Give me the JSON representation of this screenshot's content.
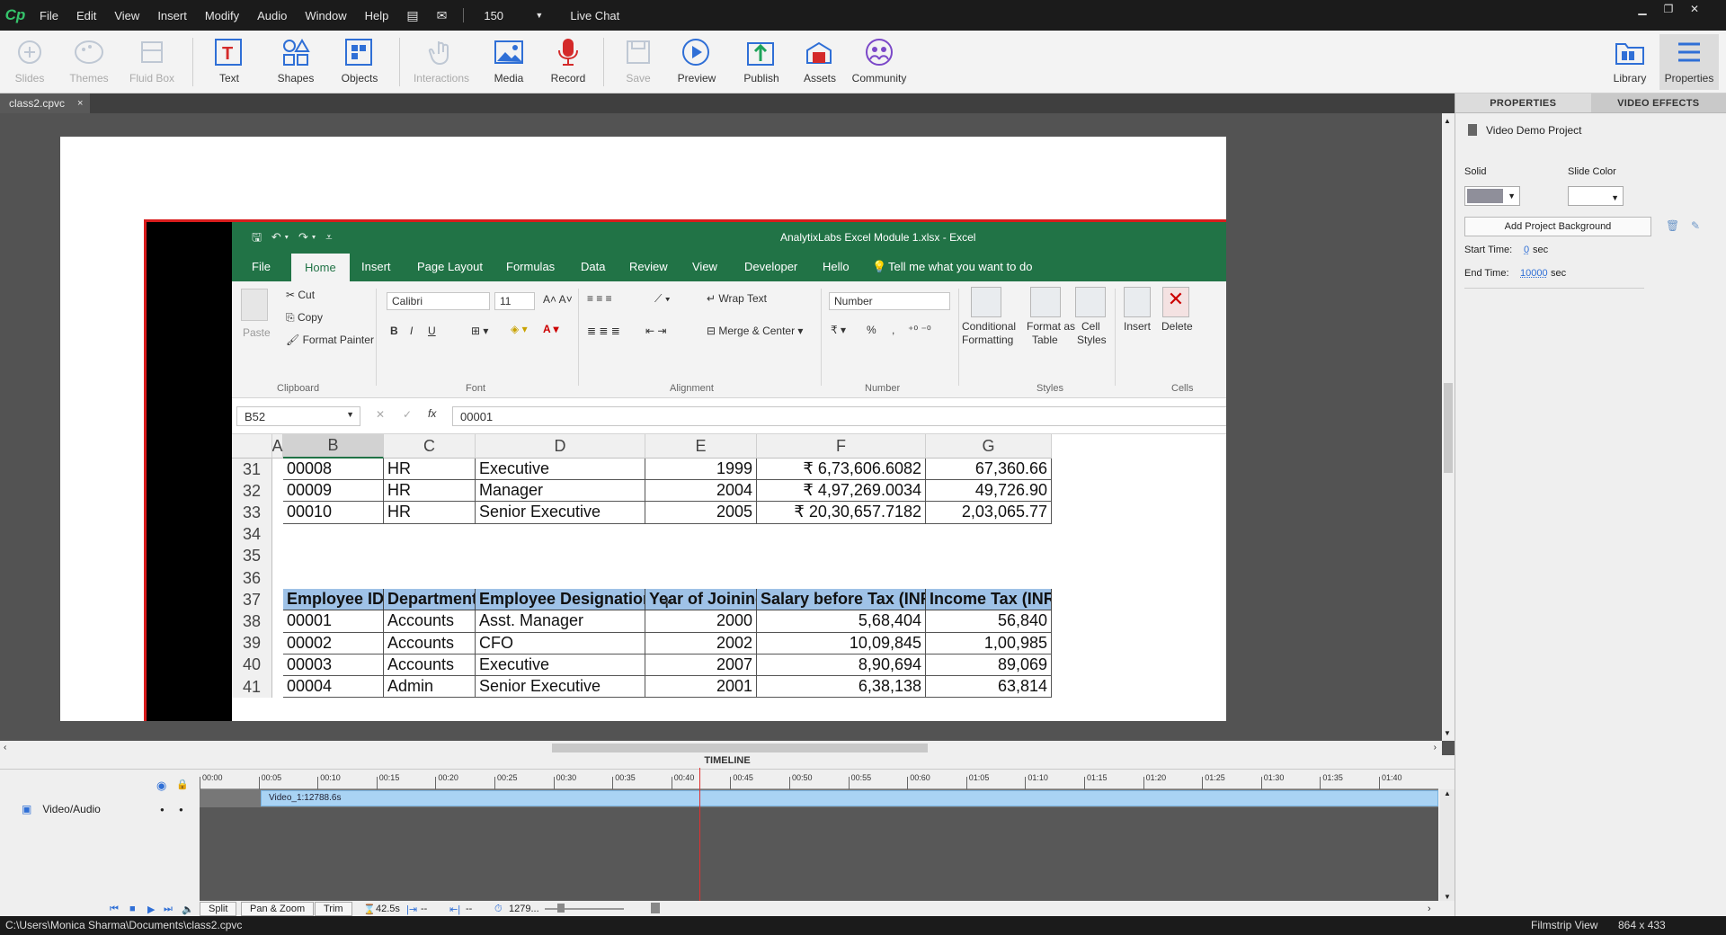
{
  "app": {
    "logo": "Cp",
    "zoom": "150",
    "live_chat": "Live Chat"
  },
  "menu": [
    "File",
    "Edit",
    "View",
    "Insert",
    "Modify",
    "Audio",
    "Window",
    "Help"
  ],
  "toolbar": {
    "slides": "Slides",
    "themes": "Themes",
    "fluid_box": "Fluid Box",
    "text": "Text",
    "shapes": "Shapes",
    "objects": "Objects",
    "interactions": "Interactions",
    "media": "Media",
    "record": "Record",
    "save": "Save",
    "preview": "Preview",
    "publish": "Publish",
    "assets": "Assets",
    "community": "Community",
    "library": "Library",
    "properties": "Properties"
  },
  "document": {
    "tab": "class2.cpvc",
    "close": "×"
  },
  "excel": {
    "title": "AnalytixLabs Excel Module 1.xlsx  -  Excel",
    "tabs": [
      "File",
      "Home",
      "Insert",
      "Page Layout",
      "Formulas",
      "Data",
      "Review",
      "View",
      "Developer",
      "Hello"
    ],
    "tell_me": "Tell me what you want to do",
    "ribbon": {
      "paste": "Paste",
      "cut": "Cut",
      "copy": "Copy",
      "format_painter": "Format Painter",
      "clipboard": "Clipboard",
      "font_name": "Calibri",
      "font_size": "11",
      "font_group": "Font",
      "bold": "B",
      "italic": "I",
      "underline": "U",
      "wrap_text": "Wrap Text",
      "merge_center": "Merge & Center",
      "alignment": "Alignment",
      "number_format": "Number",
      "number": "Number",
      "percent": "%",
      "cond_formatting_1": "Conditional",
      "cond_formatting_2": "Formatting",
      "format_table_1": "Format as",
      "format_table_2": "Table",
      "cell_styles_1": "Cell",
      "cell_styles_2": "Styles",
      "styles": "Styles",
      "insert": "Insert",
      "delete": "Delete",
      "cells": "Cells"
    },
    "name_box": "B52",
    "formula": "00001",
    "fx": "fx",
    "columns": [
      "A",
      "B",
      "C",
      "D",
      "E",
      "F",
      "G"
    ],
    "rows": [
      {
        "n": "31",
        "cells": [
          "00008",
          "HR",
          "Executive",
          "1999",
          "₹ 6,73,606.6082",
          "67,360.66"
        ]
      },
      {
        "n": "32",
        "cells": [
          "00009",
          "HR",
          "Manager",
          "2004",
          "₹ 4,97,269.0034",
          "49,726.90"
        ]
      },
      {
        "n": "33",
        "cells": [
          "00010",
          "HR",
          "Senior Executive",
          "2005",
          "₹ 20,30,657.7182",
          "2,03,065.77"
        ]
      },
      {
        "n": "34",
        "cells": [
          "",
          "",
          "",
          "",
          "",
          ""
        ]
      },
      {
        "n": "35",
        "cells": [
          "",
          "",
          "",
          "",
          "",
          ""
        ]
      },
      {
        "n": "36",
        "cells": [
          "",
          "",
          "",
          "",
          "",
          ""
        ]
      },
      {
        "n": "37",
        "cells": [
          "Employee ID",
          "Department",
          "Employee Designation",
          "Year of Joining",
          "Salary before Tax (INR)",
          "Income Tax (INR)"
        ]
      },
      {
        "n": "38",
        "cells": [
          "00001",
          "Accounts",
          "Asst. Manager",
          "2000",
          "5,68,404",
          "56,840"
        ]
      },
      {
        "n": "39",
        "cells": [
          "00002",
          "Accounts",
          "CFO",
          "2002",
          "10,09,845",
          "1,00,985"
        ]
      },
      {
        "n": "40",
        "cells": [
          "00003",
          "Accounts",
          "Executive",
          "2007",
          "8,90,694",
          "89,069"
        ]
      },
      {
        "n": "41",
        "cells": [
          "00004",
          "Admin",
          "Senior Executive",
          "2001",
          "6,38,138",
          "63,814"
        ]
      }
    ]
  },
  "properties": {
    "tabs": [
      "PROPERTIES",
      "VIDEO EFFECTS"
    ],
    "project": "Video Demo Project",
    "solid": "Solid",
    "slide_color": "Slide Color",
    "add_bg": "Add Project Background",
    "start_label": "Start Time:",
    "start_value": "0",
    "sec": "sec",
    "end_label": "End Time:",
    "end_value": "10000",
    "solid_color": "#8f8f9a"
  },
  "timeline": {
    "title": "TIMELINE",
    "track": "Video/Audio",
    "clip": "Video_1:12788.6s",
    "ticks": [
      "00:00",
      "00:05",
      "00:10",
      "00:15",
      "00:20",
      "00:25",
      "00:30",
      "00:35",
      "00:40",
      "00:45",
      "00:50",
      "00:55",
      "00:60",
      "01:05",
      "01:10",
      "01:15",
      "01:20",
      "01:25",
      "01:30",
      "01:35",
      "01:40"
    ],
    "split": "Split",
    "pan_zoom": "Pan & Zoom",
    "trim": "Trim",
    "duration": "42.5s",
    "dash1": "--",
    "dash2": "--",
    "frames": "1279..."
  },
  "status": {
    "path": "C:\\Users\\Monica Sharma\\Documents\\class2.cpvc",
    "view": "Filmstrip View",
    "size": "864 x 433"
  },
  "colors": {
    "excel_green": "#217346",
    "header_fill": "#9fc2e7",
    "border_red": "#d91c1c",
    "clip_blue": "#a9d3f4"
  }
}
